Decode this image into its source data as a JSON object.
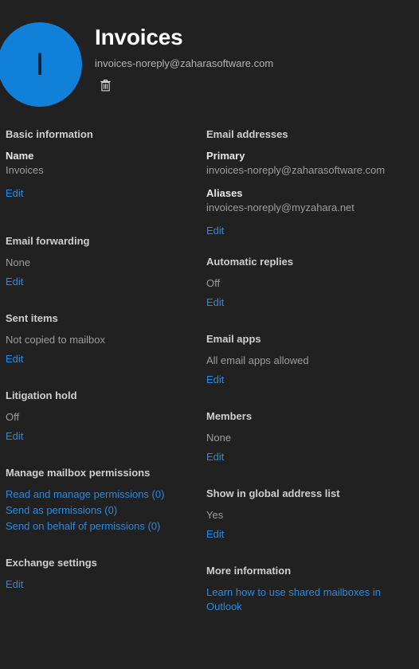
{
  "header": {
    "avatar_initial": "I",
    "title": "Invoices",
    "email": "invoices-noreply@zaharasoftware.com",
    "delete_icon": "trash-icon",
    "accent_color": "#1180d8",
    "link_color": "#2b8ae0",
    "background_color": "#212121"
  },
  "left_column": {
    "basic_information": {
      "header": "Basic information",
      "name_label": "Name",
      "name_value": "Invoices",
      "edit_label": "Edit"
    },
    "email_forwarding": {
      "header": "Email forwarding",
      "value": "None",
      "edit_label": "Edit"
    },
    "sent_items": {
      "header": "Sent items",
      "value": "Not copied to mailbox",
      "edit_label": "Edit"
    },
    "litigation_hold": {
      "header": "Litigation hold",
      "value": "Off",
      "edit_label": "Edit"
    },
    "mailbox_permissions": {
      "header": "Manage mailbox permissions",
      "links": [
        "Read and manage permissions (0)",
        "Send as permissions (0)",
        "Send on behalf of permissions (0)"
      ]
    },
    "exchange_settings": {
      "header": "Exchange settings",
      "edit_label": "Edit"
    }
  },
  "right_column": {
    "email_addresses": {
      "header": "Email addresses",
      "primary_label": "Primary",
      "primary_value": "invoices-noreply@zaharasoftware.com",
      "aliases_label": "Aliases",
      "aliases_value": "invoices-noreply@myzahara.net",
      "edit_label": "Edit"
    },
    "automatic_replies": {
      "header": "Automatic replies",
      "value": "Off",
      "edit_label": "Edit"
    },
    "email_apps": {
      "header": "Email apps",
      "value": "All email apps allowed",
      "edit_label": "Edit"
    },
    "members": {
      "header": "Members",
      "value": "None",
      "edit_label": "Edit"
    },
    "global_address_list": {
      "header": "Show in global address list",
      "value": "Yes",
      "edit_label": "Edit"
    },
    "more_information": {
      "header": "More information",
      "link": "Learn how to use shared mailboxes in Outlook"
    }
  }
}
